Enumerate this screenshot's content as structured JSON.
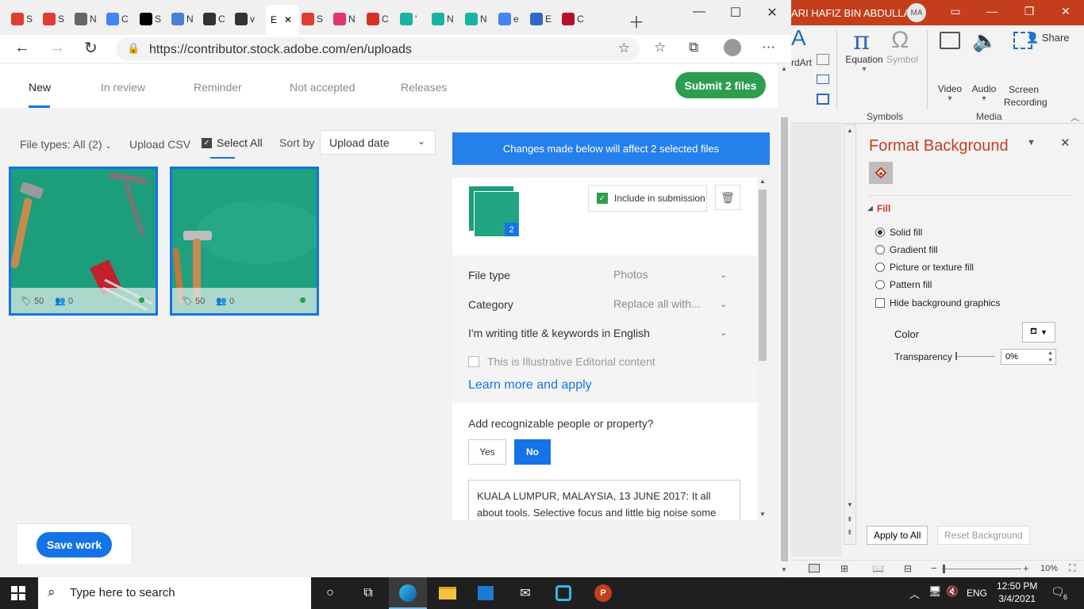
{
  "powerpoint": {
    "user_name": "ARI HAFIZ BIN ABDULLAH",
    "user_initials": "MA",
    "share_label": "Share",
    "ribbon": {
      "wordart_label": "rdArt",
      "equation_label": "Equation",
      "symbol_label": "Symbol",
      "video_label": "Video",
      "audio_label": "Audio",
      "screen_recording_label": "Screen Recording",
      "symbols_group": "Symbols",
      "media_group": "Media"
    },
    "format_background": {
      "title": "Format Background",
      "fill_section": "Fill",
      "options": [
        "Solid fill",
        "Gradient fill",
        "Picture or texture fill",
        "Pattern fill"
      ],
      "selected_option": "Solid fill",
      "hide_graphics_label": "Hide background graphics",
      "color_label": "Color",
      "transparency_label": "Transparency",
      "transparency_value": "0%",
      "apply_all_label": "Apply to All",
      "reset_label": "Reset Background"
    },
    "zoom": "10%"
  },
  "browser": {
    "url": "https://contributor.stock.adobe.com/en/uploads",
    "active_tab_label": "E",
    "tabs": [
      {
        "label": "S",
        "icon": "adobe-stock-icon",
        "color": "#e03c31"
      },
      {
        "label": "S",
        "icon": "adobe-stock-icon",
        "color": "#e03c31"
      },
      {
        "label": "N",
        "icon": "document-icon",
        "color": "#666666"
      },
      {
        "label": "C",
        "icon": "translate-icon",
        "color": "#4285f4"
      },
      {
        "label": "S",
        "icon": "tiktok-icon",
        "color": "#000000"
      },
      {
        "label": "N",
        "icon": "diagram-icon",
        "color": "#4a7fd8"
      },
      {
        "label": "C",
        "icon": "camera-icon",
        "color": "#333333"
      },
      {
        "label": "v",
        "icon": "camera2-icon",
        "color": "#333333"
      },
      {
        "label": "S",
        "icon": "adobe-icon",
        "color": "#e03c31"
      },
      {
        "label": "N",
        "icon": "spiral-icon",
        "color": "#e3346b"
      },
      {
        "label": "C",
        "icon": "gmail-icon",
        "color": "#d93025"
      },
      {
        "label": "'",
        "icon": "ob-icon",
        "color": "#19b3a3"
      },
      {
        "label": "N",
        "icon": "ob-icon",
        "color": "#19b3a3"
      },
      {
        "label": "N",
        "icon": "ob-icon",
        "color": "#19b3a3"
      },
      {
        "label": "e",
        "icon": "google-icon",
        "color": "#4285f4"
      },
      {
        "label": "E",
        "icon": "bot-icon",
        "color": "#3366cc"
      },
      {
        "label": "C",
        "icon": "flag-icon",
        "color": "#b3122e"
      }
    ]
  },
  "page": {
    "tabs": [
      "New",
      "In review",
      "Reminder",
      "Not accepted",
      "Releases"
    ],
    "active_tab": "New",
    "submit_label": "Submit 2 files",
    "filters": {
      "file_types": "File types: All (2)",
      "upload_csv": "Upload CSV",
      "select_all": "Select All",
      "sort_by": "Sort by",
      "sort_value": "Upload date"
    },
    "thumbnails": [
      {
        "keywords": "50",
        "people": "0"
      },
      {
        "keywords": "50",
        "people": "0"
      }
    ],
    "bulk_banner": "Changes made below will affect 2 selected files",
    "stack_count": "2",
    "include_label": "Include in submission",
    "fields": [
      {
        "label": "File type",
        "value": "Photos"
      },
      {
        "label": "Category",
        "value": "Replace all with..."
      },
      {
        "label": "I'm writing title & keywords in",
        "value": "English"
      }
    ],
    "editorial_label": "This is Illustrative Editorial content",
    "learn_more": "Learn more and apply",
    "people_question": "Add recognizable people or property?",
    "yes_label": "Yes",
    "no_label": "No",
    "description": "KUALA LUMPUR, MALAYSIA, 13 JUNE 2017: It all about tools. Selective focus and little big noise some area.",
    "save_label": "Save work"
  },
  "taskbar": {
    "search_placeholder": "Type here to search",
    "language": "ENG",
    "time": "12:50 PM",
    "date": "3/4/2021",
    "notification_count": "6"
  },
  "colors": {
    "adobe_blue": "#1473e6",
    "submit_green": "#2d9d4e",
    "ppt_accent": "#c43e1c"
  }
}
